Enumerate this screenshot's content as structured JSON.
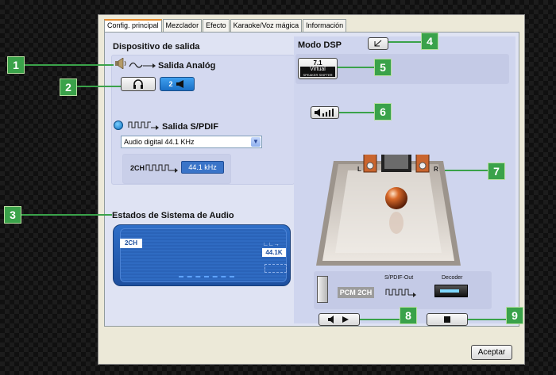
{
  "tabs": [
    {
      "label": "Config. principal",
      "active": true
    },
    {
      "label": "Mezclador"
    },
    {
      "label": "Efecto"
    },
    {
      "label": "Karaoke/Voz mágica"
    },
    {
      "label": "Información"
    }
  ],
  "output_device": {
    "heading": "Dispositivo de salida",
    "analog_label": "Salida Analóg",
    "speaker_button_label": "2",
    "spdif_label": "Salida S/PDIF",
    "spdif_format_value": "Audio digital 44.1 KHz",
    "spdif_channel_label": "2CH",
    "spdif_rate_badge": "44.1 kHz"
  },
  "status": {
    "heading": "Estados de Sistema de Audio",
    "channels": "2CH",
    "rate": "44.1K"
  },
  "dsp": {
    "heading": "Modo DSP",
    "virtual_top": "7.1",
    "virtual_mid": "Virtual",
    "virtual_bottom": "SPEAKER SHIFTER",
    "left_speaker": "L",
    "right_speaker": "R",
    "spdif_out_label": "S/PDIF-Out",
    "decoder_label": "Decoder",
    "pcm_badge": "PCM 2CH"
  },
  "callouts": [
    "1",
    "2",
    "3",
    "4",
    "5",
    "6",
    "7",
    "8",
    "9"
  ],
  "accept_label": "Aceptar",
  "colors": {
    "callout_green": "#3aa24a",
    "status_blue": "#2a63b8",
    "accent_blue": "#1a6fc6"
  }
}
